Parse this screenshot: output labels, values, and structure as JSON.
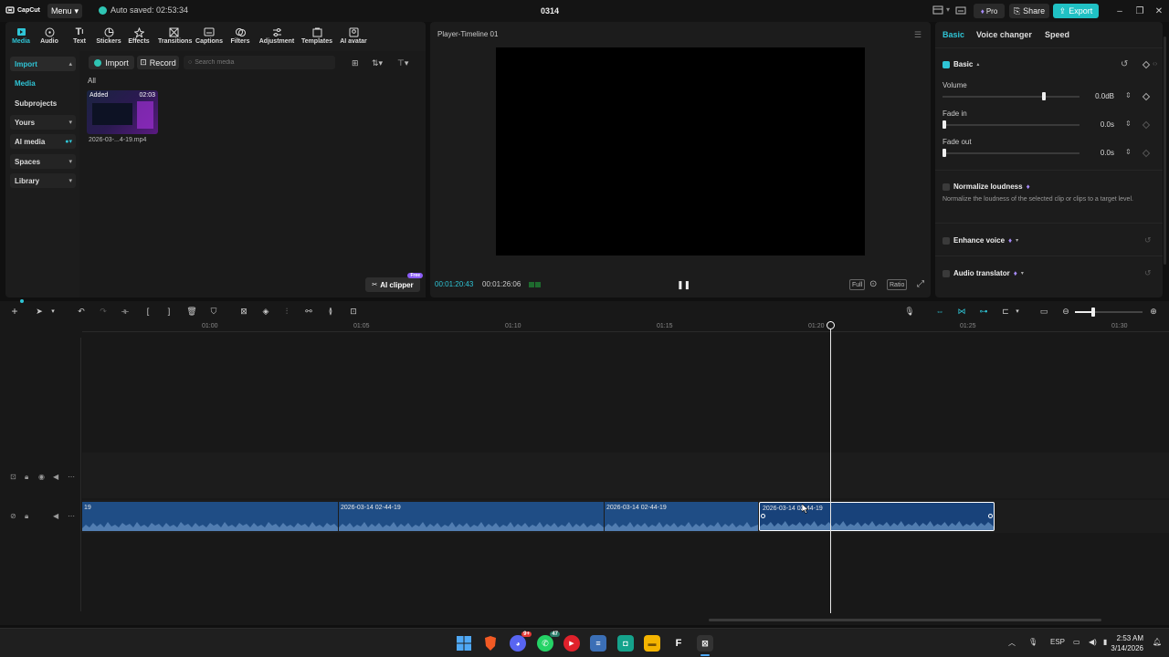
{
  "titlebar": {
    "logo": "CapCut",
    "menu_label": "Menu",
    "autosave": "Auto saved: 02:53:34",
    "project_name": "0314",
    "pro_label": "Pro",
    "share_label": "Share",
    "export_label": "Export"
  },
  "toolbar": {
    "items": [
      "Media",
      "Audio",
      "Text",
      "Stickers",
      "Effects",
      "Transitions",
      "Captions",
      "Filters",
      "Adjustment",
      "Templates",
      "AI avatar"
    ],
    "active": "Media"
  },
  "sidenav": {
    "items": [
      "Import",
      "Media",
      "Subprojects",
      "Yours",
      "AI media",
      "Spaces",
      "Library"
    ]
  },
  "media": {
    "import_label": "Import",
    "record_label": "Record",
    "search_placeholder": "Search media",
    "all_label": "All",
    "thumb_added": "Added",
    "thumb_duration": "02:03",
    "thumb_name": "2026-03-...4-19.mp4",
    "ai_clipper_label": "AI clipper",
    "free_badge": "Free"
  },
  "player": {
    "title": "Player-Timeline 01",
    "current_time": "00:01:20:43",
    "total_time": "00:01:26:06",
    "full_label": "Full",
    "ratio_label": "Ratio"
  },
  "rightpanel": {
    "tabs": [
      "Basic",
      "Voice changer",
      "Speed"
    ],
    "active_tab": "Basic",
    "basic_title": "Basic",
    "volume_label": "Volume",
    "volume_value": "0.0dB",
    "fade_in_label": "Fade in",
    "fade_in_value": "0.0s",
    "fade_out_label": "Fade out",
    "fade_out_value": "0.0s",
    "normalize_title": "Normalize loudness",
    "normalize_desc": "Normalize the loudness of the selected clip or clips to a target level.",
    "enhance_title": "Enhance voice",
    "translator_title": "Audio translator"
  },
  "timeline": {
    "ruler": [
      "01:00",
      "01:05",
      "01:10",
      "01:15",
      "01:20",
      "01:25",
      "01:30"
    ],
    "clips": [
      {
        "label": "19"
      },
      {
        "label": "2026-03-14 02-44-19"
      },
      {
        "label": "2026-03-14 02-44-19"
      },
      {
        "label": "2026-03-14 02-44-19"
      }
    ]
  },
  "taskbar": {
    "lang": "ESP",
    "time": "2:53 AM",
    "date": "3/14/2026",
    "badge_discord": "9+",
    "badge_whatsapp": "47"
  },
  "colors": {
    "accent": "#2fc5d6",
    "export": "#20c1c4",
    "clip": "#1f4d85",
    "pro": "#8b5cf6"
  }
}
